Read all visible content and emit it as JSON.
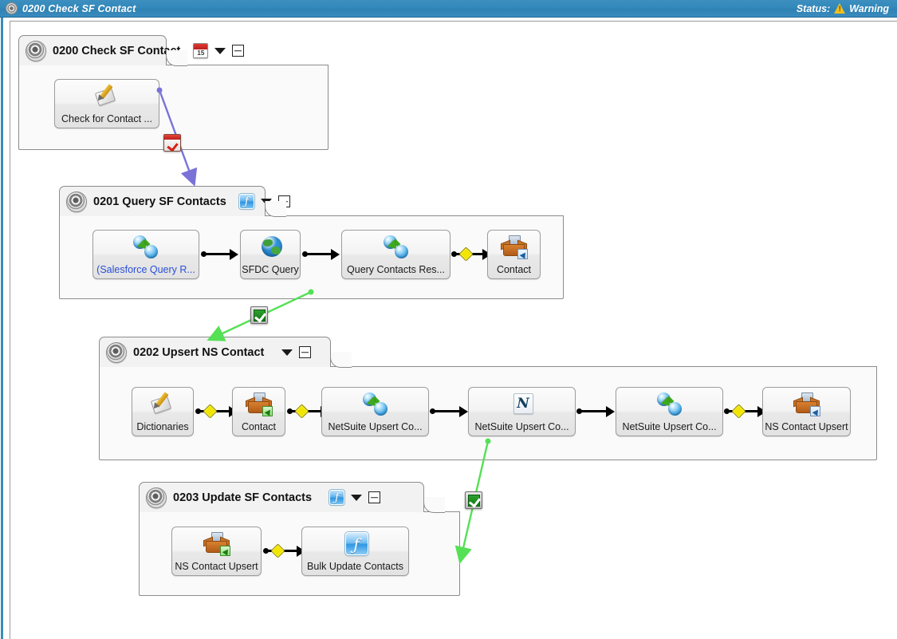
{
  "titlebar": {
    "icon": "disc-icon",
    "title": "0200 Check SF Contact",
    "status_label": "Status:",
    "status_value": "Warning",
    "status_icon": "warning-triangle-icon",
    "bg_color": "#3389bb",
    "text_color": "#ffffff"
  },
  "panels": [
    {
      "id": "p0200",
      "title": "0200 Check SF Contact",
      "badge_icon": "calendar-icon",
      "caret_icon": "chevron-down-icon",
      "minimize_icon": "minimize-icon",
      "nodes": [
        {
          "label": "Check for Contact ...",
          "icon": "pencil-page-icon",
          "link": false
        }
      ]
    },
    {
      "id": "p0201",
      "title": "0201 Query SF Contacts",
      "badge_icon": "script-function-icon",
      "caret_icon": "chevron-down-icon",
      "minimize_icon": "minimize-icon",
      "nodes": [
        {
          "label": "(Salesforce Query R...",
          "icon": "transform-icon",
          "link": true
        },
        {
          "label": "SFDC Query",
          "icon": "globe-icon",
          "link": false
        },
        {
          "label": "Query Contacts Res...",
          "icon": "transform-icon",
          "link": false
        },
        {
          "label": "Contact",
          "icon": "package-box-icon",
          "link": false
        }
      ]
    },
    {
      "id": "p0202",
      "title": "0202 Upsert NS Contact",
      "badge_icon": null,
      "caret_icon": "chevron-down-icon",
      "minimize_icon": "minimize-icon",
      "nodes": [
        {
          "label": "Dictionaries",
          "icon": "pencil-page-icon",
          "link": false
        },
        {
          "label": "Contact",
          "icon": "package-box-green-icon",
          "link": false
        },
        {
          "label": "NetSuite Upsert Co...",
          "icon": "transform-icon",
          "link": false
        },
        {
          "label": "NetSuite Upsert Co...",
          "icon": "netsuite-n-icon",
          "link": false
        },
        {
          "label": "NetSuite Upsert Co...",
          "icon": "transform-icon",
          "link": false
        },
        {
          "label": "NS Contact Upsert",
          "icon": "package-box-icon",
          "link": false
        }
      ]
    },
    {
      "id": "p0203",
      "title": "0203 Update SF Contacts",
      "badge_icon": "script-function-icon",
      "caret_icon": "chevron-down-icon",
      "minimize_icon": "minimize-icon",
      "nodes": [
        {
          "label": "NS Contact Upsert",
          "icon": "package-box-green-icon",
          "link": false
        },
        {
          "label": "Bulk Update Contacts",
          "icon": "script-function-icon",
          "link": false
        }
      ]
    }
  ],
  "flow_arrows": [
    {
      "from": "p0200",
      "to": "p0201",
      "color": "#7b72d8",
      "badge": "red-clipboard-icon"
    },
    {
      "from": "p0201",
      "to": "p0202",
      "color": "#55e055",
      "badge": "green-check-icon"
    },
    {
      "from": "p0202",
      "to": "p0203",
      "color": "#55e055",
      "badge": "green-check-icon"
    }
  ]
}
